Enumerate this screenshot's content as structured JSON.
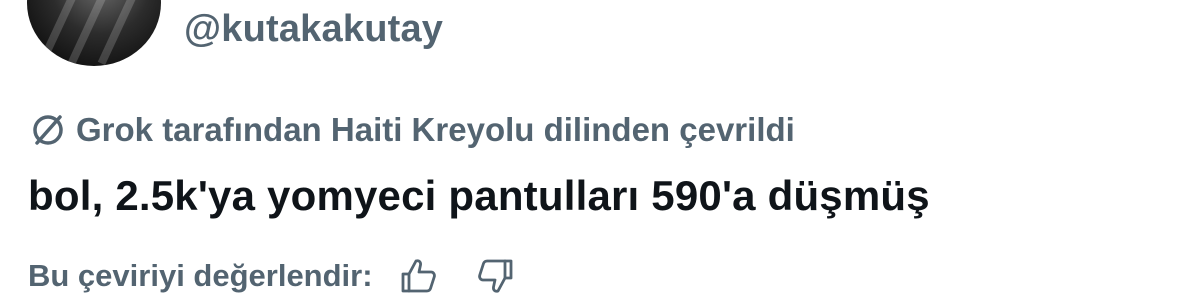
{
  "profile": {
    "handle": "@kutakakutay",
    "avatar_icon": "profile-photo"
  },
  "translation": {
    "icon": "translate-slash-icon",
    "label": "Grok tarafından Haiti Kreyolu dilinden çevrildi"
  },
  "tweet": {
    "text": "bol, 2.5k'ya yomyeci pantulları 590'a düşmüş"
  },
  "rating": {
    "label": "Bu çeviriyi değerlendir:",
    "thumbs_up_icon": "thumbs-up-icon",
    "thumbs_down_icon": "thumbs-down-icon"
  },
  "colors": {
    "text_primary": "#0f1419",
    "text_secondary": "#536471",
    "background": "#ffffff"
  }
}
